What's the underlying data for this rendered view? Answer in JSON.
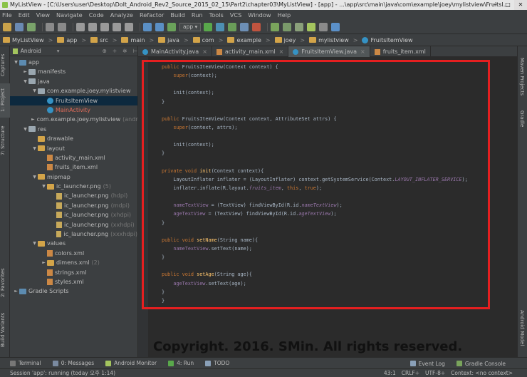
{
  "window": {
    "title": "MyListView - [C:\\Users\\user\\Desktop\\DoIt_Android_Rev2_Source_2015_02_15\\Part2\\chapter03\\MyListView] - [app] - ...\\app\\src\\main\\java\\com\\example\\joey\\mylistview\\FruitsI...",
    "buttons": [
      "─",
      "□",
      "✕"
    ]
  },
  "menu": [
    "File",
    "Edit",
    "View",
    "Navigate",
    "Code",
    "Analyze",
    "Refactor",
    "Build",
    "Run",
    "Tools",
    "VCS",
    "Window",
    "Help"
  ],
  "toolbar": {
    "config": "app ▾"
  },
  "breadcrumbs": [
    "MyListView",
    "app",
    "src",
    "main",
    "java",
    "com",
    "example",
    "joey",
    "mylistview",
    "FruitsItemView"
  ],
  "left_tabs": [
    "1: Project",
    "7: Structure",
    "Captures",
    "2: Favorites",
    "Build Variants"
  ],
  "right_tabs": [
    "Maven Projects",
    "Gradle",
    "Android Model"
  ],
  "project": {
    "view_mode": "Android",
    "tree": [
      {
        "label": "app",
        "depth": 0,
        "arrow": "▼",
        "icon": "folder-b"
      },
      {
        "label": "manifests",
        "depth": 1,
        "arrow": "►",
        "icon": "folder"
      },
      {
        "label": "java",
        "depth": 1,
        "arrow": "▼",
        "icon": "folder"
      },
      {
        "label": "com.example.joey.mylistview",
        "depth": 2,
        "arrow": "▼",
        "icon": "folder"
      },
      {
        "label": "FruitsItemView",
        "depth": 3,
        "arrow": "",
        "icon": "class",
        "selected": true
      },
      {
        "label": "MainActivity",
        "depth": 3,
        "arrow": "",
        "icon": "class",
        "red": true
      },
      {
        "label": "com.example.joey.mylistview",
        "extra": "(andro",
        "depth": 2,
        "arrow": "►",
        "icon": "folder"
      },
      {
        "label": "res",
        "depth": 1,
        "arrow": "▼",
        "icon": "folder"
      },
      {
        "label": "drawable",
        "depth": 2,
        "arrow": "",
        "icon": "folder-y"
      },
      {
        "label": "layout",
        "depth": 2,
        "arrow": "▼",
        "icon": "folder-y"
      },
      {
        "label": "activity_main.xml",
        "depth": 3,
        "arrow": "",
        "icon": "xml"
      },
      {
        "label": "fruits_item.xml",
        "depth": 3,
        "arrow": "",
        "icon": "xml"
      },
      {
        "label": "mipmap",
        "depth": 2,
        "arrow": "▼",
        "icon": "folder-y"
      },
      {
        "label": "ic_launcher.png",
        "extra": "(5)",
        "depth": 3,
        "arrow": "▼",
        "icon": "folder-y"
      },
      {
        "label": "ic_launcher.png",
        "extra": "(hdpi)",
        "depth": 4,
        "arrow": "",
        "icon": "file"
      },
      {
        "label": "ic_launcher.png",
        "extra": "(mdpi)",
        "depth": 4,
        "arrow": "",
        "icon": "file"
      },
      {
        "label": "ic_launcher.png",
        "extra": "(xhdpi)",
        "depth": 4,
        "arrow": "",
        "icon": "file"
      },
      {
        "label": "ic_launcher.png",
        "extra": "(xxhdpi)",
        "depth": 4,
        "arrow": "",
        "icon": "file"
      },
      {
        "label": "ic_launcher.png",
        "extra": "(xxxhdpi)",
        "depth": 4,
        "arrow": "",
        "icon": "file"
      },
      {
        "label": "values",
        "depth": 2,
        "arrow": "▼",
        "icon": "folder-y"
      },
      {
        "label": "colors.xml",
        "depth": 3,
        "arrow": "",
        "icon": "xml"
      },
      {
        "label": "dimens.xml",
        "extra": "(2)",
        "depth": 3,
        "arrow": "►",
        "icon": "folder-y"
      },
      {
        "label": "strings.xml",
        "depth": 3,
        "arrow": "",
        "icon": "xml"
      },
      {
        "label": "styles.xml",
        "depth": 3,
        "arrow": "",
        "icon": "xml"
      },
      {
        "label": "Gradle Scripts",
        "depth": 0,
        "arrow": "►",
        "icon": "gradle"
      }
    ]
  },
  "editor_tabs": [
    {
      "label": "MainActivity.java",
      "type": "class",
      "active": false
    },
    {
      "label": "activity_main.xml",
      "type": "xml",
      "active": false
    },
    {
      "label": "FruitsItemView.java",
      "type": "class",
      "active": true
    },
    {
      "label": "fruits_item.xml",
      "type": "xml",
      "active": false
    }
  ],
  "code_lines": [
    [
      [
        "kw",
        "public "
      ],
      [
        "",
        "FruitsItemView(Context context) {"
      ]
    ],
    [
      [
        "",
        "    "
      ],
      [
        "kw",
        "super"
      ],
      [
        "",
        "(context);"
      ]
    ],
    [
      [
        "",
        ""
      ]
    ],
    [
      [
        "",
        "    init(context);"
      ]
    ],
    [
      [
        "",
        "}"
      ]
    ],
    [
      [
        "",
        ""
      ]
    ],
    [
      [
        "kw",
        "public "
      ],
      [
        "",
        "FruitsItemView(Context context, AttributeSet attrs) {"
      ]
    ],
    [
      [
        "",
        "    "
      ],
      [
        "kw",
        "super"
      ],
      [
        "",
        "(context, attrs);"
      ]
    ],
    [
      [
        "",
        ""
      ]
    ],
    [
      [
        "",
        "    init(context);"
      ]
    ],
    [
      [
        "",
        "}"
      ]
    ],
    [
      [
        "",
        ""
      ]
    ],
    [
      [
        "kw",
        "private void "
      ],
      [
        "fn",
        "init"
      ],
      [
        "",
        "(Context context){"
      ]
    ],
    [
      [
        "",
        "    LayoutInflater inflater = (LayoutInflater) context.getSystemService(Context."
      ],
      [
        "fdi",
        "LAYOUT_INFLATER_SERVICE"
      ],
      [
        "",
        ");"
      ]
    ],
    [
      [
        "",
        "    inflater.inflate(R.layout."
      ],
      [
        "fdi",
        "fruits_item"
      ],
      [
        "",
        ", "
      ],
      [
        "kw",
        "this"
      ],
      [
        "",
        ", "
      ],
      [
        "kw",
        "true"
      ],
      [
        "",
        ");"
      ]
    ],
    [
      [
        "",
        ""
      ]
    ],
    [
      [
        "",
        "    "
      ],
      [
        "fd",
        "nameTextView"
      ],
      [
        "",
        " = (TextView) findViewById(R.id."
      ],
      [
        "fdi",
        "nameTextView"
      ],
      [
        "",
        ");"
      ]
    ],
    [
      [
        "",
        "    "
      ],
      [
        "fd",
        "ageTextView"
      ],
      [
        "",
        " = (TextView) findViewById(R.id."
      ],
      [
        "fdi",
        "ageTextView"
      ],
      [
        "",
        ");"
      ]
    ],
    [
      [
        "",
        "}"
      ]
    ],
    [
      [
        "",
        ""
      ]
    ],
    [
      [
        "kw",
        "public void "
      ],
      [
        "fn",
        "setName"
      ],
      [
        "",
        "(String name){"
      ]
    ],
    [
      [
        "",
        "    "
      ],
      [
        "fd",
        "nameTextView"
      ],
      [
        "",
        ".setText(name);"
      ]
    ],
    [
      [
        "",
        "}"
      ]
    ],
    [
      [
        "",
        ""
      ]
    ],
    [
      [
        "kw",
        "public void "
      ],
      [
        "fn",
        "setAge"
      ],
      [
        "",
        "(String age){"
      ]
    ],
    [
      [
        "",
        "    "
      ],
      [
        "fd",
        "ageTextView"
      ],
      [
        "",
        ".setText(age);"
      ]
    ],
    [
      [
        "",
        "}"
      ]
    ],
    [
      [
        "",
        "}"
      ]
    ]
  ],
  "watermark": "Copyright. 2016. SMin. All rights reserved.",
  "bottom_tools": [
    "Terminal",
    "0: Messages",
    "Android Monitor",
    "4: Run",
    "TODO"
  ],
  "bottom_tools_right": [
    "Event Log",
    "Gradle Console"
  ],
  "status": {
    "message": "Session 'app': running (today 오후 1:14)",
    "position": "43:1",
    "line_sep": "CRLF÷",
    "encoding": "UTF-8÷",
    "context": "Context: <no context>"
  }
}
